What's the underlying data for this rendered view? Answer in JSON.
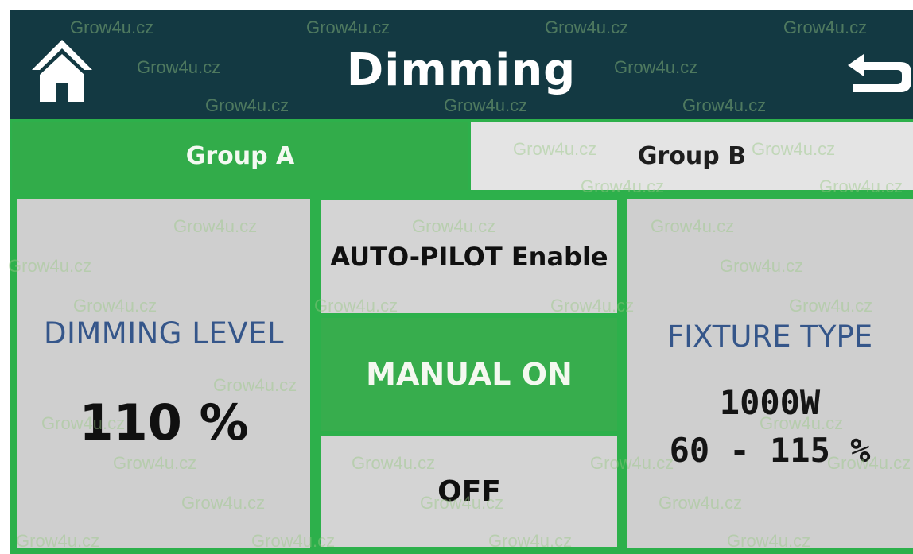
{
  "header": {
    "title": "Dimming",
    "home_icon": "home-icon",
    "back_icon": "back-arrow-icon"
  },
  "tabs": [
    {
      "label": "Group A",
      "active": true
    },
    {
      "label": "Group B",
      "active": false
    }
  ],
  "dimming": {
    "label": "DIMMING LEVEL",
    "value": "110 %"
  },
  "modes": {
    "auto_pilot": "AUTO-PILOT Enable",
    "manual_on": "MANUAL ON",
    "off": "OFF",
    "selected": "MANUAL ON"
  },
  "fixture": {
    "label": "FIXTURE TYPE",
    "wattage": "1000W",
    "range": "60 - 115 %"
  },
  "watermark": "Grow4u.cz",
  "colors": {
    "header_bg": "#133942",
    "accent_green": "#2db04b",
    "panel_gray": "#cfcfcf",
    "label_blue": "#35568a"
  }
}
